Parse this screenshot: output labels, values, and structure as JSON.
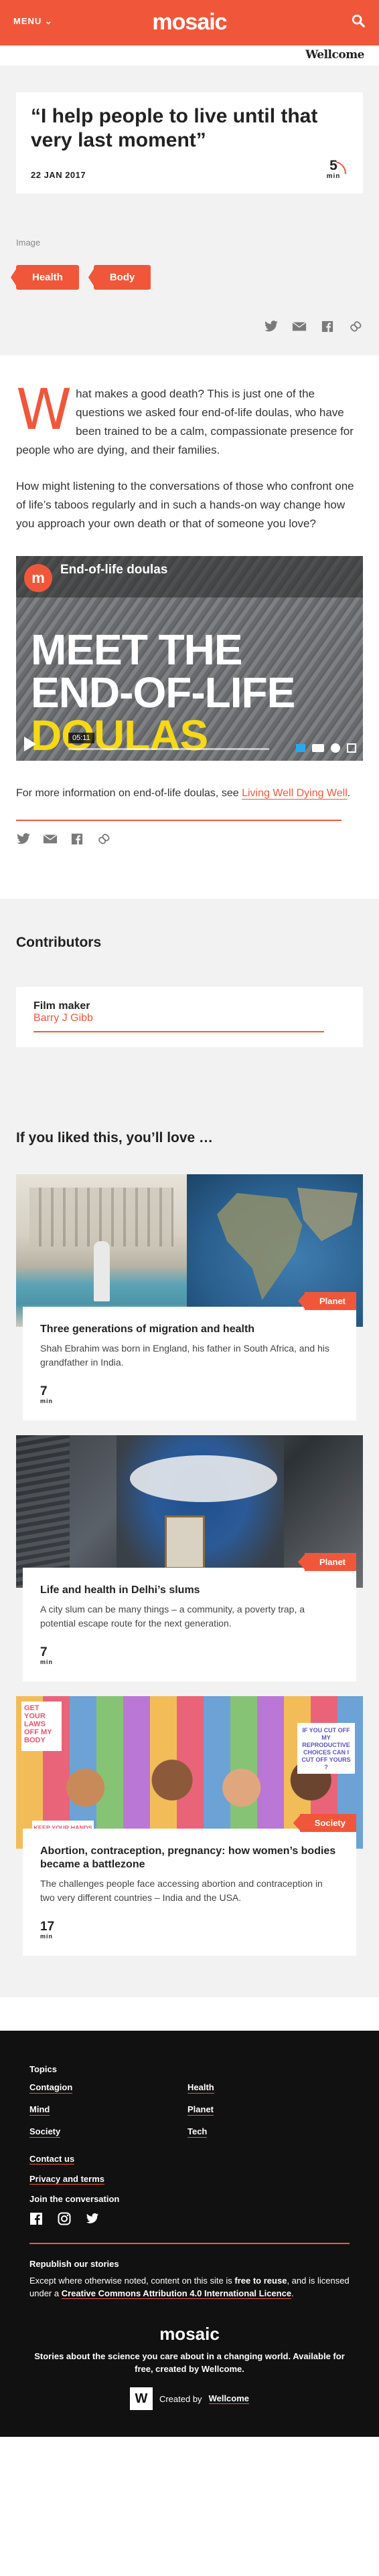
{
  "header": {
    "menu_label": "MENU",
    "logo": "mosaic",
    "partner": "Wellcome",
    "brand_color": "#f0573a"
  },
  "article": {
    "title": "“I help people to live until that very last moment”",
    "date": "22 JAN 2017",
    "read_minutes": "5",
    "read_label": "min",
    "image_caption": "Image",
    "tags": [
      "Health",
      "Body"
    ],
    "dropcap": "W",
    "lead_rest": "hat makes a good death? This is just one of the questions we asked four end-of-life doulas, who have been trained to be a calm, compassionate presence for people who are dying, and their families.",
    "paragraph2": "How might listening to the conversations of those who confront one of life’s taboos regularly and in such a hands-on way change how you approach your own death or that of someone you love?",
    "video": {
      "channel_icon": "m",
      "channel_title": "End-of-life doulas",
      "headline_line1": "MEET THE",
      "headline_line2": "END-OF-LIFE",
      "headline_line3": "DOULAS",
      "timestamp": "05:11"
    },
    "more_info_prefix": "For more information on end-of-life doulas, see ",
    "more_info_link": "Living Well Dying Well",
    "more_info_suffix": "."
  },
  "contributors": {
    "heading": "Contributors",
    "items": [
      {
        "role": "Film maker",
        "name": "Barry J Gibb"
      }
    ]
  },
  "related": {
    "heading": "If you liked this, you’ll love …",
    "items": [
      {
        "title": "Three generations of migration and health",
        "summary": "Shah Ebrahim was born in England, his father in South Africa, and his grandfather in India.",
        "minutes": "7",
        "label": "min",
        "tag": "Planet"
      },
      {
        "title": "Life and health in Delhi’s slums",
        "summary": "A city slum can be many things – a community, a poverty trap, a potential escape route for the next generation.",
        "minutes": "7",
        "label": "min",
        "tag": "Planet"
      },
      {
        "title": "Abortion, contraception, pregnancy: how women’s bodies became a battlezone",
        "summary": "The challenges people face accessing abortion and contraception in two very different countries – India and the USA.",
        "minutes": "17",
        "label": "min",
        "tag": "Society"
      }
    ],
    "poster_texts": [
      "GET YOUR LAWS OFF MY BODY",
      "KEEP YOUR HANDS",
      "IF YOU CUT OFF MY REPRODUCTIVE CHOICES CAN I CUT OFF YOURS ?"
    ]
  },
  "footer": {
    "topics_heading": "Topics",
    "topics": [
      "Contagion",
      "Health",
      "Mind",
      "Planet",
      "Society",
      "Tech"
    ],
    "contact": "Contact us",
    "privacy": "Privacy and terms",
    "join": "Join the conversation",
    "republish_heading": "Republish our stories",
    "republish_p1": "Except where otherwise noted, content on this site is ",
    "republish_free": "free to reuse",
    "republish_p2": ", and is licensed under a ",
    "republish_license": "Creative Commons Attribution 4.0 International Licence",
    "republish_p3": ".",
    "brand": "mosaic",
    "tagline": "Stories about the science you care about in a changing world. Available for free, created by Wellcome.",
    "created_by_prefix": "Created by",
    "created_by": "Wellcome",
    "w_logo": "W"
  }
}
